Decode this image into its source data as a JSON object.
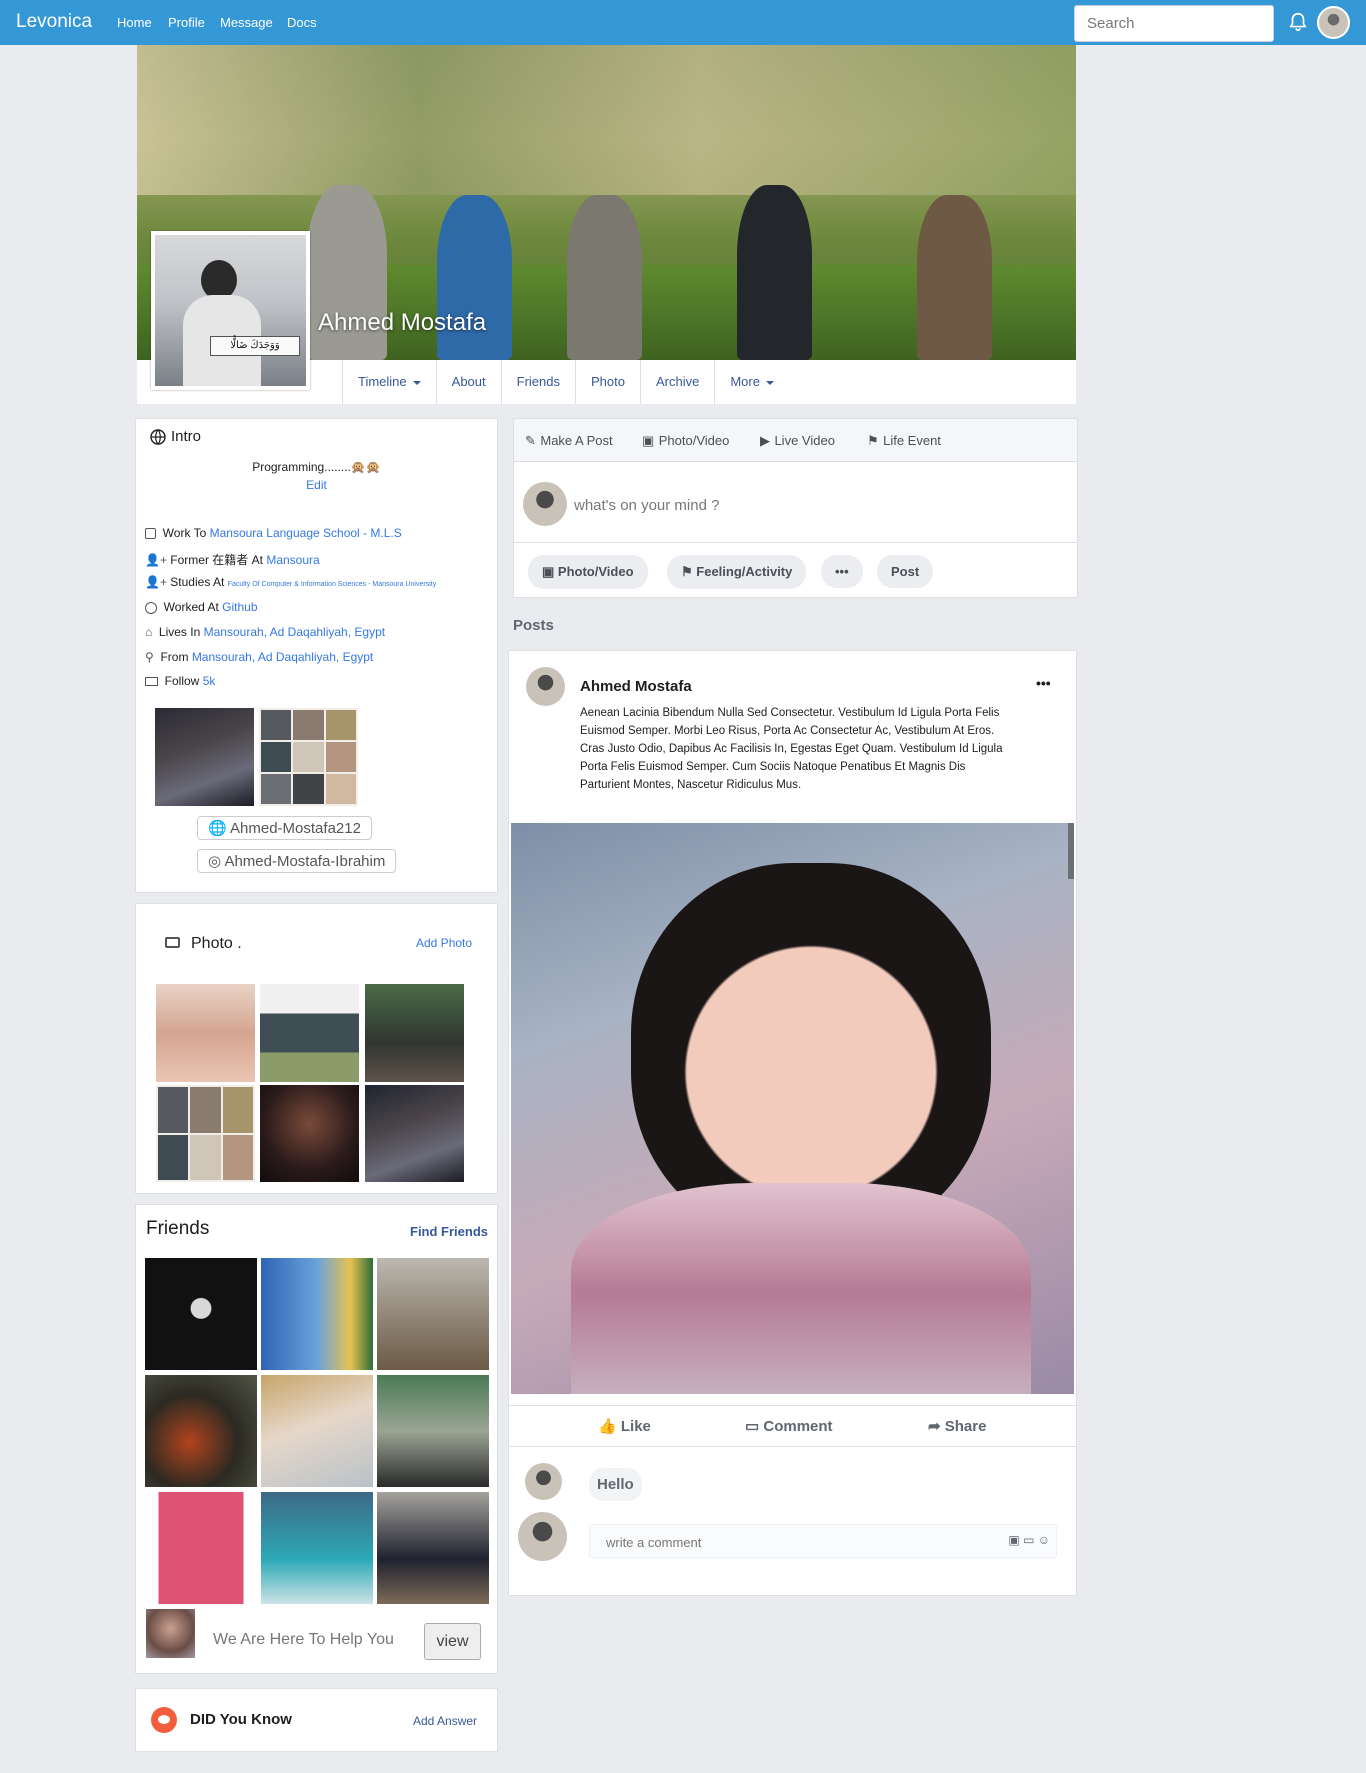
{
  "nav": {
    "brand": "Levonica",
    "links": [
      "Home",
      "Profile",
      "Message",
      "Docs"
    ],
    "search_placeholder": "Search"
  },
  "profile": {
    "name": "Ahmed Mostafa",
    "tabs": [
      "Timeline",
      "About",
      "Friends",
      "Photo",
      "Archive",
      "More"
    ]
  },
  "intro": {
    "title": "Intro",
    "bio": "Programming........🙊🙊",
    "edit": "Edit",
    "rows": [
      {
        "icon": "calendar-icon",
        "prefix": "Work To",
        "value": "Mansoura Language School - M.L.S"
      },
      {
        "icon": "user-plus-icon",
        "prefix": "Former 在籍者 At",
        "value": "Mansoura"
      },
      {
        "icon": "user-plus-icon",
        "prefix": "Studies At",
        "value": "Faculty Of Computer & Information Sciences - Mansoura University"
      },
      {
        "icon": "github-icon",
        "prefix": "Worked At",
        "value": "Github"
      },
      {
        "icon": "home-icon",
        "prefix": "Lives In",
        "value": "Mansourah, Ad Daqahliyah, Egypt"
      },
      {
        "icon": "map-pin-icon",
        "prefix": "From",
        "value": "Mansourah, Ad Daqahliyah, Egypt"
      },
      {
        "icon": "id-card-icon",
        "prefix": "Follow",
        "value": "5k"
      }
    ],
    "website": "Ahmed-Mostafa212",
    "instagram": "Ahmed-Mostafa-Ibrahim"
  },
  "photos": {
    "title": "Photo .",
    "add": "Add Photo"
  },
  "friends": {
    "title": "Friends",
    "find": "Find Friends",
    "help_text": "We Are Here To Help You",
    "view": "view"
  },
  "didyouknow": {
    "title": "DID You Know",
    "add": "Add Answer"
  },
  "composer": {
    "tabs": [
      "Make A Post",
      "Photo/Video",
      "Live Video",
      "Life Event"
    ],
    "placeholder": "what's on your mind ?",
    "buttons": [
      "Photo/Video",
      "Feeling/Activity",
      "•••",
      "Post"
    ]
  },
  "posts_label": "Posts",
  "post": {
    "author": "Ahmed Mostafa",
    "more": "•••",
    "text": "Aenean Lacinia Bibendum Nulla Sed Consectetur. Vestibulum Id Ligula Porta Felis Euismod Semper. Morbi Leo Risus, Porta Ac Consectetur Ac, Vestibulum At Eros. Cras Justo Odio, Dapibus Ac Facilisis In, Egestas Eget Quam. Vestibulum Id Ligula Porta Felis Euismod Semper. Cum Sociis Natoque Penatibus Et Magnis Dis Parturient Montes, Nascetur Ridiculus Mus.",
    "actions": [
      "Like",
      "Comment",
      "Share"
    ],
    "comment": "Hello",
    "comment_placeholder": "write a comment"
  }
}
